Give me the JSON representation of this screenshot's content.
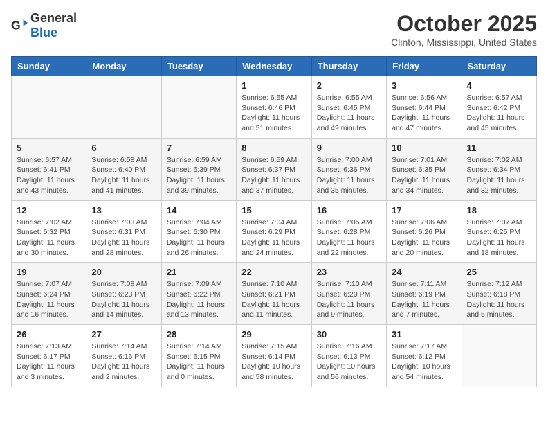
{
  "header": {
    "logo_general": "General",
    "logo_blue": "Blue",
    "month": "October 2025",
    "location": "Clinton, Mississippi, United States"
  },
  "weekdays": [
    "Sunday",
    "Monday",
    "Tuesday",
    "Wednesday",
    "Thursday",
    "Friday",
    "Saturday"
  ],
  "weeks": [
    [
      {
        "day": "",
        "info": ""
      },
      {
        "day": "",
        "info": ""
      },
      {
        "day": "",
        "info": ""
      },
      {
        "day": "1",
        "info": "Sunrise: 6:55 AM\nSunset: 6:46 PM\nDaylight: 11 hours and 51 minutes."
      },
      {
        "day": "2",
        "info": "Sunrise: 6:55 AM\nSunset: 6:45 PM\nDaylight: 11 hours and 49 minutes."
      },
      {
        "day": "3",
        "info": "Sunrise: 6:56 AM\nSunset: 6:44 PM\nDaylight: 11 hours and 47 minutes."
      },
      {
        "day": "4",
        "info": "Sunrise: 6:57 AM\nSunset: 6:42 PM\nDaylight: 11 hours and 45 minutes."
      }
    ],
    [
      {
        "day": "5",
        "info": "Sunrise: 6:57 AM\nSunset: 6:41 PM\nDaylight: 11 hours and 43 minutes."
      },
      {
        "day": "6",
        "info": "Sunrise: 6:58 AM\nSunset: 6:40 PM\nDaylight: 11 hours and 41 minutes."
      },
      {
        "day": "7",
        "info": "Sunrise: 6:59 AM\nSunset: 6:39 PM\nDaylight: 11 hours and 39 minutes."
      },
      {
        "day": "8",
        "info": "Sunrise: 6:59 AM\nSunset: 6:37 PM\nDaylight: 11 hours and 37 minutes."
      },
      {
        "day": "9",
        "info": "Sunrise: 7:00 AM\nSunset: 6:36 PM\nDaylight: 11 hours and 35 minutes."
      },
      {
        "day": "10",
        "info": "Sunrise: 7:01 AM\nSunset: 6:35 PM\nDaylight: 11 hours and 34 minutes."
      },
      {
        "day": "11",
        "info": "Sunrise: 7:02 AM\nSunset: 6:34 PM\nDaylight: 11 hours and 32 minutes."
      }
    ],
    [
      {
        "day": "12",
        "info": "Sunrise: 7:02 AM\nSunset: 6:32 PM\nDaylight: 11 hours and 30 minutes."
      },
      {
        "day": "13",
        "info": "Sunrise: 7:03 AM\nSunset: 6:31 PM\nDaylight: 11 hours and 28 minutes."
      },
      {
        "day": "14",
        "info": "Sunrise: 7:04 AM\nSunset: 6:30 PM\nDaylight: 11 hours and 26 minutes."
      },
      {
        "day": "15",
        "info": "Sunrise: 7:04 AM\nSunset: 6:29 PM\nDaylight: 11 hours and 24 minutes."
      },
      {
        "day": "16",
        "info": "Sunrise: 7:05 AM\nSunset: 6:28 PM\nDaylight: 11 hours and 22 minutes."
      },
      {
        "day": "17",
        "info": "Sunrise: 7:06 AM\nSunset: 6:26 PM\nDaylight: 11 hours and 20 minutes."
      },
      {
        "day": "18",
        "info": "Sunrise: 7:07 AM\nSunset: 6:25 PM\nDaylight: 11 hours and 18 minutes."
      }
    ],
    [
      {
        "day": "19",
        "info": "Sunrise: 7:07 AM\nSunset: 6:24 PM\nDaylight: 11 hours and 16 minutes."
      },
      {
        "day": "20",
        "info": "Sunrise: 7:08 AM\nSunset: 6:23 PM\nDaylight: 11 hours and 14 minutes."
      },
      {
        "day": "21",
        "info": "Sunrise: 7:09 AM\nSunset: 6:22 PM\nDaylight: 11 hours and 13 minutes."
      },
      {
        "day": "22",
        "info": "Sunrise: 7:10 AM\nSunset: 6:21 PM\nDaylight: 11 hours and 11 minutes."
      },
      {
        "day": "23",
        "info": "Sunrise: 7:10 AM\nSunset: 6:20 PM\nDaylight: 11 hours and 9 minutes."
      },
      {
        "day": "24",
        "info": "Sunrise: 7:11 AM\nSunset: 6:19 PM\nDaylight: 11 hours and 7 minutes."
      },
      {
        "day": "25",
        "info": "Sunrise: 7:12 AM\nSunset: 6:18 PM\nDaylight: 11 hours and 5 minutes."
      }
    ],
    [
      {
        "day": "26",
        "info": "Sunrise: 7:13 AM\nSunset: 6:17 PM\nDaylight: 11 hours and 3 minutes."
      },
      {
        "day": "27",
        "info": "Sunrise: 7:14 AM\nSunset: 6:16 PM\nDaylight: 11 hours and 2 minutes."
      },
      {
        "day": "28",
        "info": "Sunrise: 7:14 AM\nSunset: 6:15 PM\nDaylight: 11 hours and 0 minutes."
      },
      {
        "day": "29",
        "info": "Sunrise: 7:15 AM\nSunset: 6:14 PM\nDaylight: 10 hours and 58 minutes."
      },
      {
        "day": "30",
        "info": "Sunrise: 7:16 AM\nSunset: 6:13 PM\nDaylight: 10 hours and 56 minutes."
      },
      {
        "day": "31",
        "info": "Sunrise: 7:17 AM\nSunset: 6:12 PM\nDaylight: 10 hours and 54 minutes."
      },
      {
        "day": "",
        "info": ""
      }
    ]
  ]
}
